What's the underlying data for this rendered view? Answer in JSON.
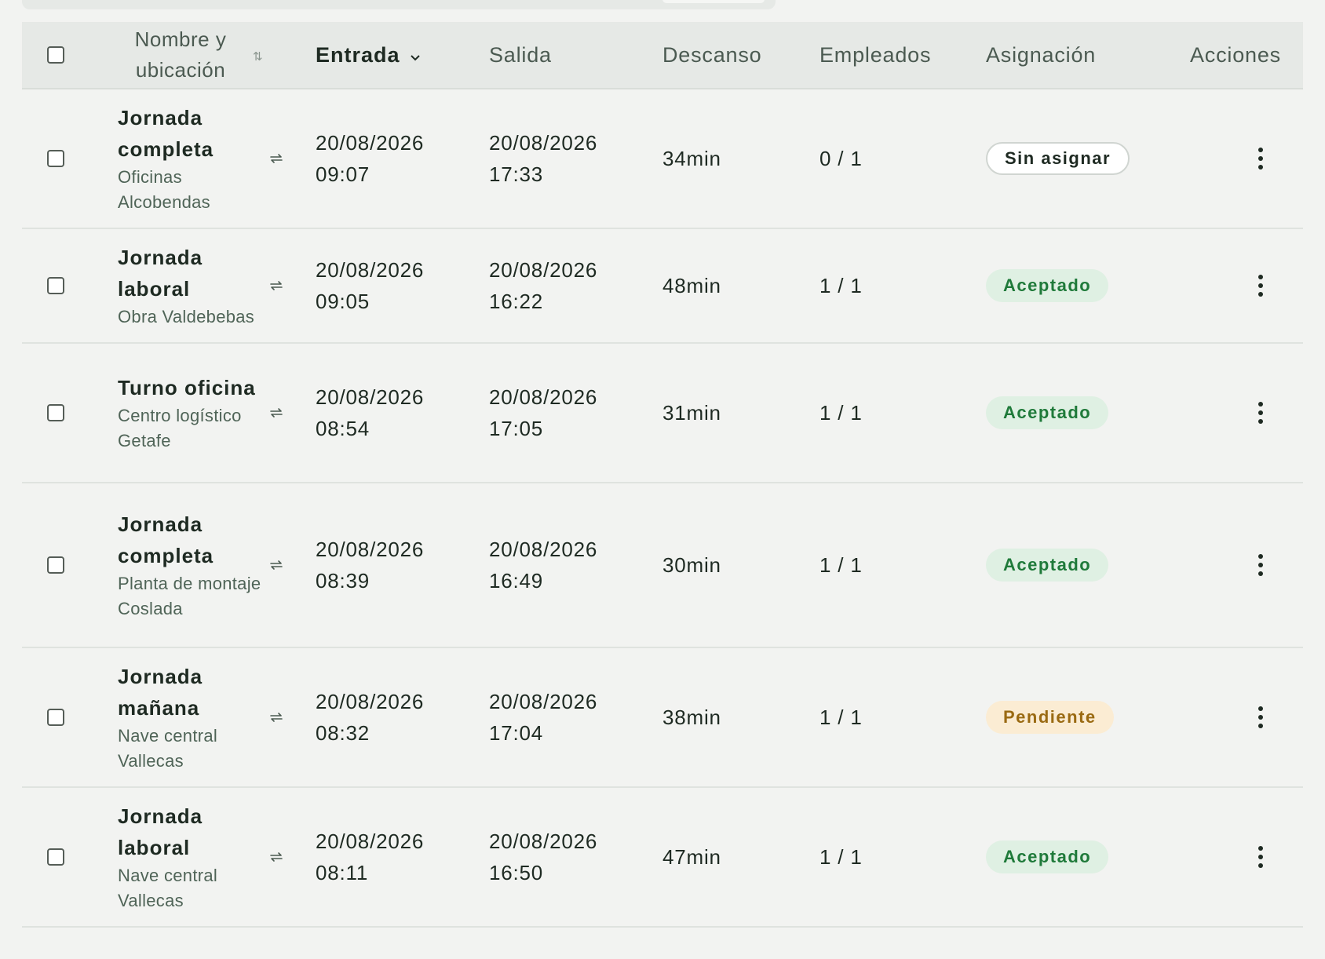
{
  "header": {
    "name_col": "Nombre y ubicación",
    "entrada_col": "Entrada",
    "salida_col": "Salida",
    "descanso_col": "Descanso",
    "empleados_col": "Empleados",
    "asignacion_col": "Asignación",
    "acciones_col": "Acciones"
  },
  "rows": [
    {
      "name": "Jornada completa",
      "location": "Oficinas Alcobendas",
      "entrada": [
        "20/08/2026",
        "09:07"
      ],
      "salida": [
        "20/08/2026",
        "17:33"
      ],
      "descanso": "34min",
      "empleados": "0 / 1",
      "asignacion": "Sin asignar",
      "status": "none"
    },
    {
      "name": "Jornada laboral",
      "location": "Obra Valdebebas",
      "entrada": [
        "20/08/2026",
        "09:05"
      ],
      "salida": [
        "20/08/2026",
        "16:22"
      ],
      "descanso": "48min",
      "empleados": "1 / 1",
      "asignacion": "Aceptado",
      "status": "ok"
    },
    {
      "name": "Turno oficina",
      "location": "Centro logístico Getafe",
      "entrada": [
        "20/08/2026",
        "08:54"
      ],
      "salida": [
        "20/08/2026",
        "17:05"
      ],
      "descanso": "31min",
      "empleados": "1 / 1",
      "asignacion": "Aceptado",
      "status": "ok"
    },
    {
      "name": "Jornada completa",
      "location": "Planta de montaje Coslada",
      "entrada": [
        "20/08/2026",
        "08:39"
      ],
      "salida": [
        "20/08/2026",
        "16:49"
      ],
      "descanso": "30min",
      "empleados": "1 / 1",
      "asignacion": "Aceptado",
      "status": "ok"
    },
    {
      "name": "Jornada mañana",
      "location": "Nave central Vallecas",
      "entrada": [
        "20/08/2026",
        "08:32"
      ],
      "salida": [
        "20/08/2026",
        "17:04"
      ],
      "descanso": "38min",
      "empleados": "1 / 1",
      "asignacion": "Pendiente",
      "status": "pend"
    },
    {
      "name": "Jornada laboral",
      "location": "Nave central Vallecas",
      "entrada": [
        "20/08/2026",
        "08:11"
      ],
      "salida": [
        "20/08/2026",
        "16:50"
      ],
      "descanso": "47min",
      "empleados": "1 / 1",
      "asignacion": "Aceptado",
      "status": "ok"
    }
  ],
  "icons": {
    "sort": "sort-icon",
    "sorted_desc": "chevron-down-icon",
    "recurring": "repeat-icon",
    "actions": "more-vertical-icon"
  },
  "colors": {
    "accepted_bg": "#dff0e3",
    "accepted_text": "#1f7a3a",
    "pending_bg": "#fbecd3",
    "pending_text": "#9a6a12"
  }
}
